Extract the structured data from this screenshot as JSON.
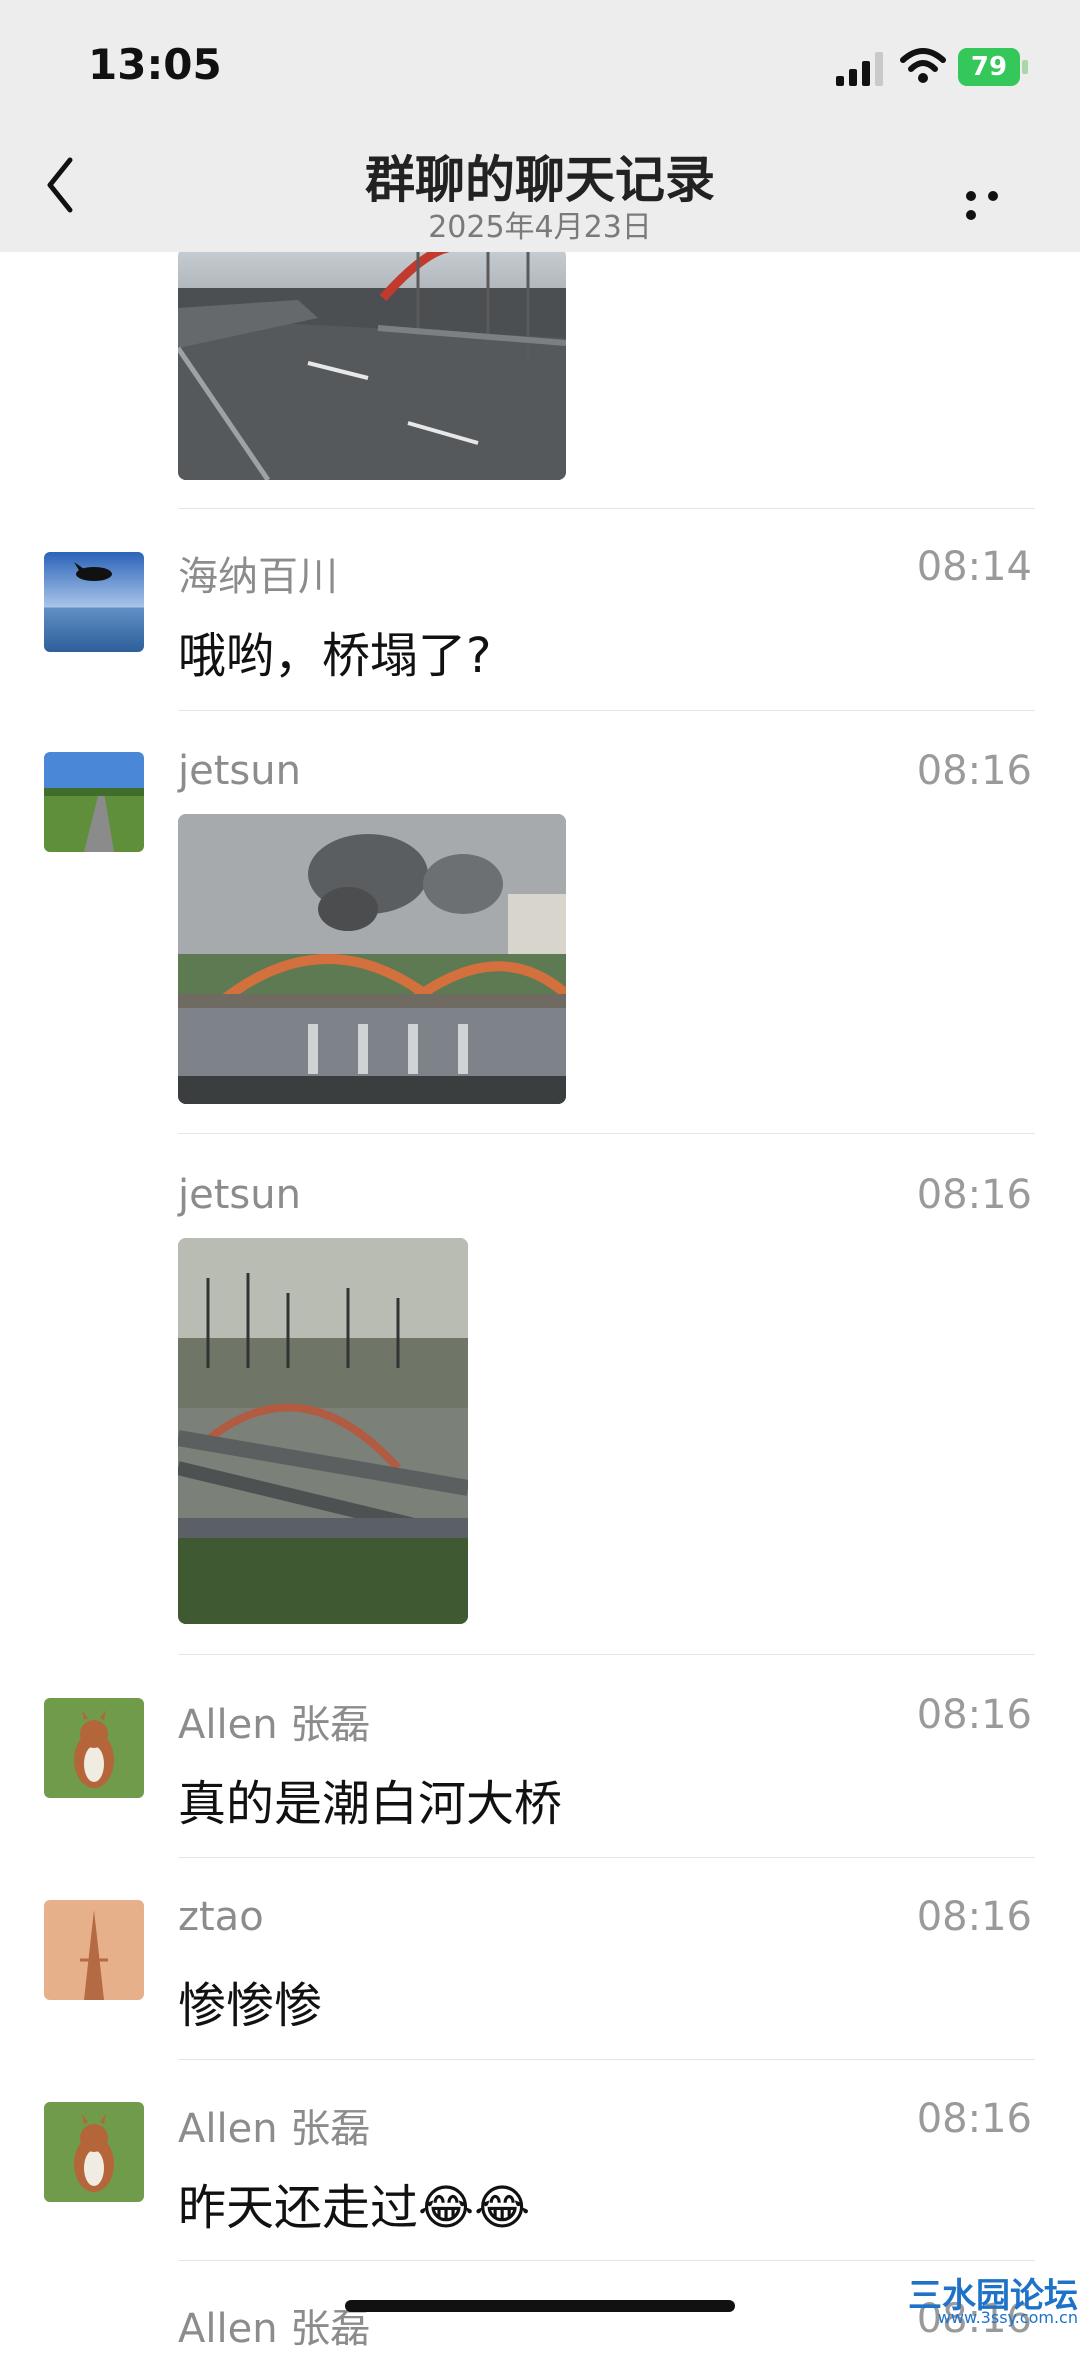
{
  "status_bar": {
    "time": "13:05",
    "battery": "79"
  },
  "header": {
    "title": "群聊的聊天记录",
    "subtitle": "2025年4月23日"
  },
  "messages": [
    {
      "sender": "海纳百川",
      "time": "08:14",
      "text": "哦哟，桥塌了?"
    },
    {
      "sender": "jetsun",
      "time": "08:16"
    },
    {
      "sender": "jetsun",
      "time": "08:16"
    },
    {
      "sender": "Allen 张磊",
      "time": "08:16",
      "text": "真的是潮白河大桥"
    },
    {
      "sender": "ztao",
      "time": "08:16",
      "text": "惨惨惨"
    },
    {
      "sender": "Allen 张磊",
      "time": "08:16",
      "text": "昨天还走过😂😂"
    },
    {
      "sender": "Allen 张磊",
      "time": "08:16"
    }
  ],
  "watermark": {
    "main": "三水园论坛",
    "sub": "www.3ssy.com.cn"
  },
  "colors": {
    "header_bg": "#ededed",
    "battery": "#34c759",
    "divider": "#e6e6e6"
  }
}
